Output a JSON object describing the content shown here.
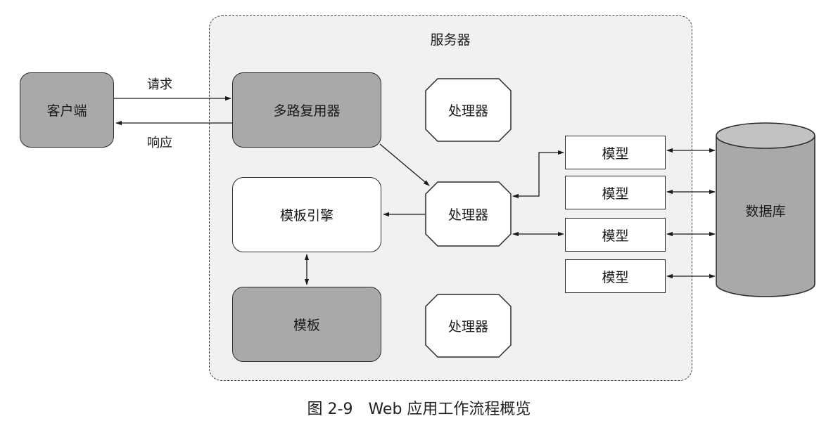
{
  "server": {
    "label": "服务器"
  },
  "client": {
    "label": "客户端"
  },
  "edges": {
    "request": "请求",
    "response": "响应"
  },
  "multiplexer": {
    "label": "多路复用器"
  },
  "template_engine": {
    "label": "模板引擎"
  },
  "template": {
    "label": "模板"
  },
  "handlers": [
    {
      "label": "处理器"
    },
    {
      "label": "处理器"
    },
    {
      "label": "处理器"
    }
  ],
  "models": [
    {
      "label": "模型"
    },
    {
      "label": "模型"
    },
    {
      "label": "模型"
    },
    {
      "label": "模型"
    }
  ],
  "database": {
    "label": "数据库"
  },
  "caption": "图 2-9　Web 应用工作流程概览",
  "colors": {
    "gray_fill": "#a9a9a9",
    "server_fill": "#f1f1f1",
    "stroke": "#2a2a2a"
  }
}
